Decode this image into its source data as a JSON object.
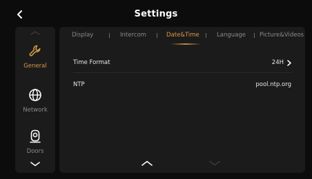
{
  "header": {
    "title": "Settings"
  },
  "sidebar": {
    "items": [
      {
        "label": "General",
        "icon": "wrench-icon",
        "active": true
      },
      {
        "label": "Network",
        "icon": "globe-icon",
        "active": false
      },
      {
        "label": "Doors",
        "icon": "door-camera-icon",
        "active": false
      }
    ]
  },
  "tabs": [
    {
      "label": "Display",
      "active": false
    },
    {
      "label": "Intercom",
      "active": false
    },
    {
      "label": "Date&Time",
      "active": true
    },
    {
      "label": "Language",
      "active": false
    },
    {
      "label": "Picture&Videos",
      "active": false
    }
  ],
  "settings": [
    {
      "label": "Time Format",
      "value": "24H",
      "has_arrow": true
    },
    {
      "label": "NTP",
      "value": "pool.ntp.org",
      "has_arrow": false
    }
  ],
  "colors": {
    "accent": "#d79a4a",
    "background": "#0c0c0c",
    "panel": "#1b1b1b",
    "text_muted": "#8a8a8a"
  }
}
